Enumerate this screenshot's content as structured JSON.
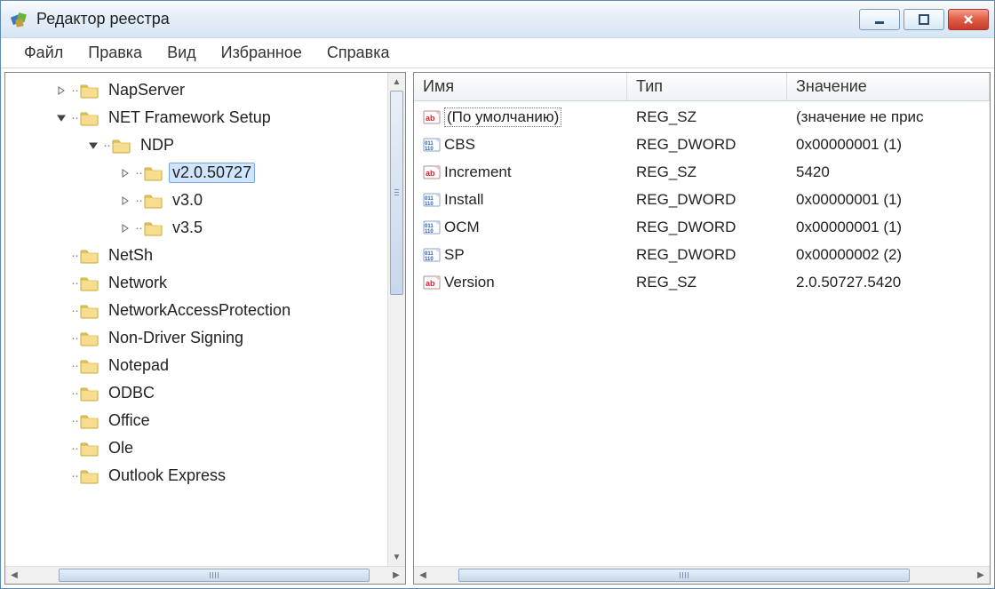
{
  "window": {
    "title": "Редактор реестра"
  },
  "menu": {
    "file": "Файл",
    "edit": "Правка",
    "view": "Вид",
    "favorites": "Избранное",
    "help": "Справка"
  },
  "tree": {
    "items": [
      {
        "depth": 1,
        "expander": "right",
        "label": "NapServer"
      },
      {
        "depth": 1,
        "expander": "down",
        "label": "NET Framework Setup"
      },
      {
        "depth": 2,
        "expander": "down",
        "label": "NDP"
      },
      {
        "depth": 3,
        "expander": "right",
        "label": "v2.0.50727",
        "selected": true
      },
      {
        "depth": 3,
        "expander": "right",
        "label": "v3.0"
      },
      {
        "depth": 3,
        "expander": "right",
        "label": "v3.5"
      },
      {
        "depth": 1,
        "expander": "none",
        "label": "NetSh"
      },
      {
        "depth": 1,
        "expander": "none",
        "label": "Network"
      },
      {
        "depth": 1,
        "expander": "none",
        "label": "NetworkAccessProtection"
      },
      {
        "depth": 1,
        "expander": "none",
        "label": "Non-Driver Signing"
      },
      {
        "depth": 1,
        "expander": "none",
        "label": "Notepad"
      },
      {
        "depth": 1,
        "expander": "none",
        "label": "ODBC"
      },
      {
        "depth": 1,
        "expander": "none",
        "label": "Office"
      },
      {
        "depth": 1,
        "expander": "none",
        "label": "Ole"
      },
      {
        "depth": 1,
        "expander": "none",
        "label": "Outlook Express"
      }
    ]
  },
  "list": {
    "headers": {
      "name": "Имя",
      "type": "Тип",
      "value": "Значение"
    },
    "rows": [
      {
        "icon": "sz",
        "name": "(По умолчанию)",
        "type": "REG_SZ",
        "value": "(значение не прис",
        "is_default": true
      },
      {
        "icon": "bin",
        "name": "CBS",
        "type": "REG_DWORD",
        "value": "0x00000001 (1)"
      },
      {
        "icon": "sz",
        "name": "Increment",
        "type": "REG_SZ",
        "value": "5420"
      },
      {
        "icon": "bin",
        "name": "Install",
        "type": "REG_DWORD",
        "value": "0x00000001 (1)"
      },
      {
        "icon": "bin",
        "name": "OCM",
        "type": "REG_DWORD",
        "value": "0x00000001 (1)"
      },
      {
        "icon": "bin",
        "name": "SP",
        "type": "REG_DWORD",
        "value": "0x00000002 (2)"
      },
      {
        "icon": "sz",
        "name": "Version",
        "type": "REG_SZ",
        "value": "2.0.50727.5420"
      }
    ]
  }
}
